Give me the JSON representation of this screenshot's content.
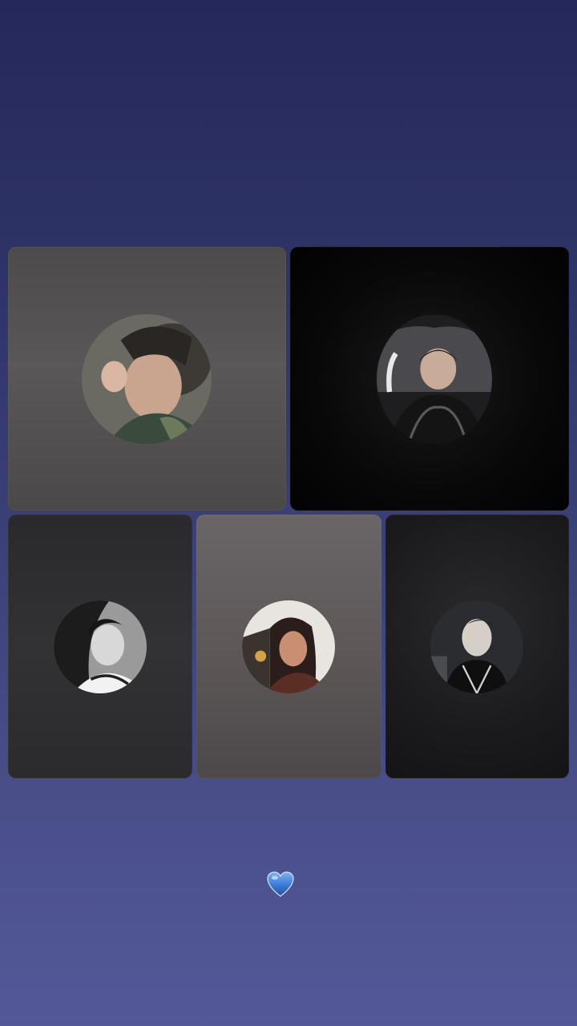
{
  "call": {
    "participants": [
      {
        "id": "p1",
        "avatar_icon": "avatar-photo-icon",
        "tone": "warm-gray"
      },
      {
        "id": "p2",
        "avatar_icon": "avatar-photo-icon",
        "tone": "black"
      },
      {
        "id": "p3",
        "avatar_icon": "avatar-photo-icon",
        "tone": "dark-gray"
      },
      {
        "id": "p4",
        "avatar_icon": "avatar-photo-icon",
        "tone": "taupe"
      },
      {
        "id": "p5",
        "avatar_icon": "avatar-photo-icon",
        "tone": "charcoal"
      }
    ],
    "reaction": {
      "icon": "blue-heart-icon",
      "color": "#3f7fd8"
    }
  },
  "colors": {
    "background_top": "#25285a",
    "background_bottom": "#535998",
    "heart": "#3f7fd8"
  }
}
